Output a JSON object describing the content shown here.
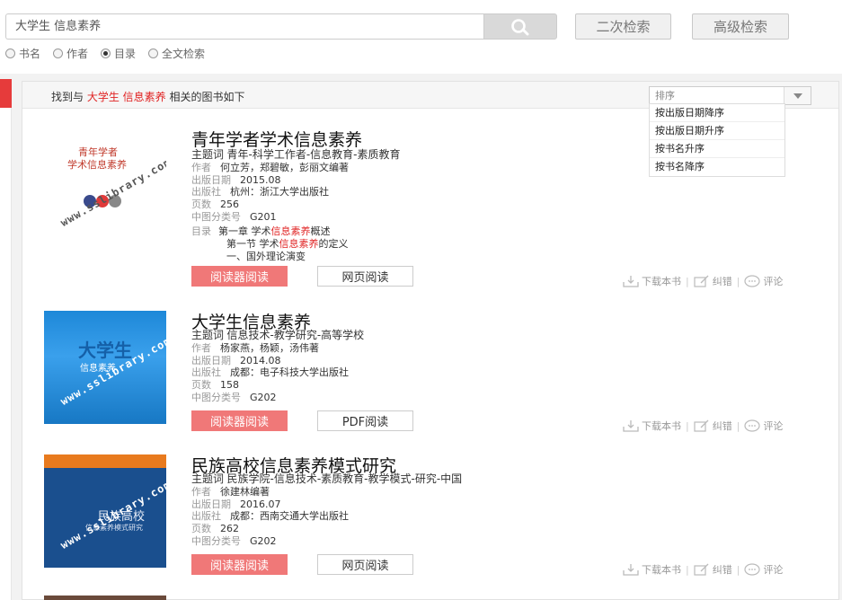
{
  "search": {
    "query": "大学生  信息素养",
    "second_search_label": "二次检索",
    "advanced_search_label": "高级检索",
    "modes": [
      {
        "label": "书名",
        "selected": false
      },
      {
        "label": "作者",
        "selected": false
      },
      {
        "label": "目录",
        "selected": true
      },
      {
        "label": "全文检索",
        "selected": false
      }
    ]
  },
  "results": {
    "prefix": "找到与",
    "keyword": "大学生 信息素养",
    "suffix": "相关的图书如下"
  },
  "sort": {
    "placeholder": "排序",
    "options": [
      "按出版日期降序",
      "按出版日期升序",
      "按书名升序",
      "按书名降序"
    ]
  },
  "labels": {
    "topic": "主题词",
    "author": "作者",
    "pubdate": "出版日期",
    "publisher": "出版社",
    "pages": "页数",
    "clc": "中图分类号",
    "toc": "目录",
    "download": "下载本书",
    "error": "纠错",
    "comment": "评论",
    "reader": "阅读器阅读"
  },
  "books": [
    {
      "title": "青年学者学术信息素养",
      "topic": "青年-科学工作者-信息教育-素质教育",
      "author": "何立芳，郑碧敏，彭丽文编著",
      "pubdate": "2015.08",
      "publisher": "杭州：浙江大学出版社",
      "pages": "256",
      "clc": "G201",
      "toc": [
        {
          "pre": "第一章 学术",
          "hl": "信息素养",
          "post": "概述"
        },
        {
          "pre": "第一节 学术",
          "hl": "信息素养",
          "post": "的定义"
        },
        {
          "pre": "一、国外理论演变",
          "hl": "",
          "post": ""
        }
      ],
      "read_label": "网页阅读",
      "cover": {
        "title1": "青年学者",
        "title2": "学术信息素养",
        "watermark": "www.sslibrary.com"
      }
    },
    {
      "title": "大学生信息素养",
      "topic": "信息技术-教学研究-高等学校",
      "author": "杨家燕，杨颖，汤伟著",
      "pubdate": "2014.08",
      "publisher": "成都：电子科技大学出版社",
      "pages": "158",
      "clc": "G202",
      "read_label": "PDF阅读",
      "cover": {
        "title1": "大学生",
        "title2": "信息素养",
        "watermark": "www.sslibrary.com"
      }
    },
    {
      "title": "民族高校信息素养模式研究",
      "topic": "民族学院-信息技术-素质教育-教学模式-研究-中国",
      "author": "徐建林编著",
      "pubdate": "2016.07",
      "publisher": "成都：西南交通大学出版社",
      "pages": "262",
      "clc": "G202",
      "read_label": "网页阅读",
      "cover": {
        "title1": "民族高校",
        "title2": "信息素养模式研究",
        "watermark": "www.sslibrary.com"
      }
    }
  ],
  "colors": {
    "accent_red": "#e02424",
    "reader_button": "#f07878"
  }
}
